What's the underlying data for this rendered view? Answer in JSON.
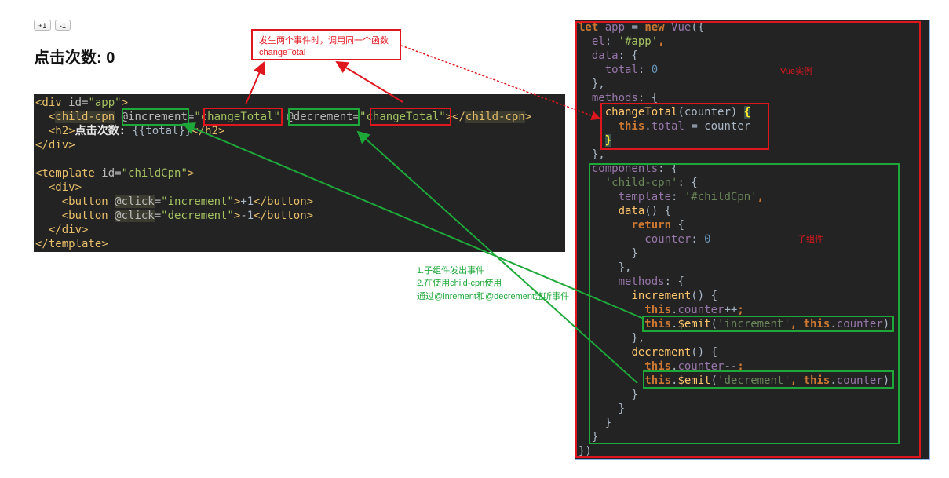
{
  "demo": {
    "buttons": [
      "+1",
      "-1"
    ],
    "title": "点击次数: 0"
  },
  "callout": {
    "line1": "发生两个事件时，调用同一个函数",
    "line2": "changeTotal"
  },
  "labels": {
    "vue_instance": "Vue实例",
    "child_component": "子组件"
  },
  "green_note": [
    "1.子组件发出事件",
    "2.在使用child-cpn使用",
    "通过@inrement和@decrement监听事件"
  ],
  "colors": {
    "red_annotation": "#e0161e",
    "green_annotation": "#1ea83a",
    "editor_bg": "#232323"
  },
  "html_code": [
    [
      [
        "tg",
        "<div "
      ],
      [
        "at",
        "id="
      ],
      [
        "s",
        "\"app\""
      ],
      [
        "tg",
        ">"
      ]
    ],
    [
      [
        "t",
        "  "
      ],
      [
        "tg",
        "<"
      ],
      [
        "hl tg",
        "child-cpn"
      ],
      [
        "t",
        " "
      ],
      [
        "at",
        "@increment="
      ],
      [
        "s",
        "\"changeTotal\""
      ],
      [
        "t",
        " "
      ],
      [
        "at",
        "@decrement="
      ],
      [
        "s",
        "\"changeTotal\""
      ],
      [
        "tg",
        "></"
      ],
      [
        "hl tg",
        "child-cpn"
      ],
      [
        "tg",
        ">"
      ]
    ],
    [
      [
        "t",
        "  "
      ],
      [
        "tg",
        "<h2>"
      ],
      [
        "w",
        "点击次数: "
      ],
      [
        "t",
        "{{total}}"
      ],
      [
        "tg",
        "</h2>"
      ]
    ],
    [
      [
        "tg",
        "</div>"
      ]
    ],
    [
      [
        "t",
        ""
      ]
    ],
    [
      [
        "tg",
        "<template "
      ],
      [
        "at",
        "id="
      ],
      [
        "s",
        "\"childCpn\""
      ],
      [
        "tg",
        ">"
      ]
    ],
    [
      [
        "t",
        "  "
      ],
      [
        "tg",
        "<div>"
      ]
    ],
    [
      [
        "t",
        "    "
      ],
      [
        "tg",
        "<button "
      ],
      [
        "hl at",
        "@click"
      ],
      [
        "at",
        "="
      ],
      [
        "s",
        "\"increment\""
      ],
      [
        "tg",
        ">"
      ],
      [
        "t",
        "+1"
      ],
      [
        "tg",
        "</button>"
      ]
    ],
    [
      [
        "t",
        "    "
      ],
      [
        "tg",
        "<button "
      ],
      [
        "hl at",
        "@click"
      ],
      [
        "at",
        "="
      ],
      [
        "s",
        "\"decrement\""
      ],
      [
        "tg",
        ">"
      ],
      [
        "t",
        "-1"
      ],
      [
        "tg",
        "</button>"
      ]
    ],
    [
      [
        "t",
        "  "
      ],
      [
        "tg",
        "</div>"
      ]
    ],
    [
      [
        "tg",
        "</template>"
      ]
    ]
  ],
  "js_code": [
    [
      [
        "k",
        "let "
      ],
      [
        "p",
        "app"
      ],
      [
        "t",
        " = "
      ],
      [
        "k",
        "new "
      ],
      [
        "p",
        "Vue"
      ],
      [
        "t",
        "({"
      ]
    ],
    [
      [
        "t",
        "  "
      ],
      [
        "p",
        "el"
      ],
      [
        "t",
        ": "
      ],
      [
        "s",
        "'#app'"
      ],
      [
        "k",
        ","
      ]
    ],
    [
      [
        "t",
        "  "
      ],
      [
        "p",
        "data"
      ],
      [
        "t",
        ": {"
      ]
    ],
    [
      [
        "t",
        "    "
      ],
      [
        "p",
        "total"
      ],
      [
        "t",
        ": "
      ],
      [
        "n",
        "0"
      ]
    ],
    [
      [
        "t",
        "  },"
      ]
    ],
    [
      [
        "t",
        "  "
      ],
      [
        "p",
        "methods"
      ],
      [
        "t",
        ": {"
      ]
    ],
    [
      [
        "t",
        "    "
      ],
      [
        "f",
        "changeTotal"
      ],
      [
        "t",
        "(counter) "
      ],
      [
        "y",
        "{"
      ]
    ],
    [
      [
        "t",
        "      "
      ],
      [
        "k",
        "this"
      ],
      [
        "t",
        "."
      ],
      [
        "p",
        "total"
      ],
      [
        "t",
        " = counter"
      ]
    ],
    [
      [
        "t",
        "    "
      ],
      [
        "y",
        "}"
      ]
    ],
    [
      [
        "t",
        "  },"
      ]
    ],
    [
      [
        "t",
        "  "
      ],
      [
        "p",
        "components"
      ],
      [
        "t",
        ": {"
      ]
    ],
    [
      [
        "t",
        "    "
      ],
      [
        "sd",
        "'child-cpn'"
      ],
      [
        "t",
        ": {"
      ]
    ],
    [
      [
        "t",
        "      "
      ],
      [
        "p",
        "template"
      ],
      [
        "t",
        ": "
      ],
      [
        "sd",
        "'#childCpn'"
      ],
      [
        "k",
        ","
      ]
    ],
    [
      [
        "t",
        "      "
      ],
      [
        "f",
        "data"
      ],
      [
        "t",
        "() {"
      ]
    ],
    [
      [
        "t",
        "        "
      ],
      [
        "k",
        "return"
      ],
      [
        "t",
        " {"
      ]
    ],
    [
      [
        "t",
        "          "
      ],
      [
        "p",
        "counter"
      ],
      [
        "t",
        ": "
      ],
      [
        "n",
        "0"
      ]
    ],
    [
      [
        "t",
        "        }"
      ]
    ],
    [
      [
        "t",
        "      },"
      ]
    ],
    [
      [
        "t",
        "      "
      ],
      [
        "p",
        "methods"
      ],
      [
        "t",
        ": {"
      ]
    ],
    [
      [
        "t",
        "        "
      ],
      [
        "f",
        "increment"
      ],
      [
        "t",
        "() {"
      ]
    ],
    [
      [
        "t",
        "          "
      ],
      [
        "k",
        "this"
      ],
      [
        "t",
        "."
      ],
      [
        "p",
        "counter"
      ],
      [
        "t",
        "++"
      ],
      [
        "k",
        ";"
      ]
    ],
    [
      [
        "t",
        "          "
      ],
      [
        "k",
        "this"
      ],
      [
        "t",
        "."
      ],
      [
        "f",
        "$emit"
      ],
      [
        "t",
        "("
      ],
      [
        "sd",
        "'increment'"
      ],
      [
        "k",
        ", this"
      ],
      [
        "t",
        "."
      ],
      [
        "p",
        "counter"
      ],
      [
        "t",
        ")"
      ]
    ],
    [
      [
        "t",
        "        },"
      ]
    ],
    [
      [
        "t",
        "        "
      ],
      [
        "f",
        "decrement"
      ],
      [
        "t",
        "() {"
      ]
    ],
    [
      [
        "t",
        "          "
      ],
      [
        "k",
        "this"
      ],
      [
        "t",
        "."
      ],
      [
        "p",
        "counter"
      ],
      [
        "t",
        "--"
      ],
      [
        "k",
        ";"
      ]
    ],
    [
      [
        "t",
        "          "
      ],
      [
        "k",
        "this"
      ],
      [
        "t",
        "."
      ],
      [
        "f",
        "$emit"
      ],
      [
        "t",
        "("
      ],
      [
        "sd",
        "'decrement'"
      ],
      [
        "k",
        ", this"
      ],
      [
        "t",
        "."
      ],
      [
        "p",
        "counter"
      ],
      [
        "t",
        ")"
      ]
    ],
    [
      [
        "t",
        "        }"
      ]
    ],
    [
      [
        "t",
        "      }"
      ]
    ],
    [
      [
        "t",
        "    }"
      ]
    ],
    [
      [
        "t",
        "  }"
      ]
    ],
    [
      [
        "t",
        "})"
      ]
    ]
  ]
}
